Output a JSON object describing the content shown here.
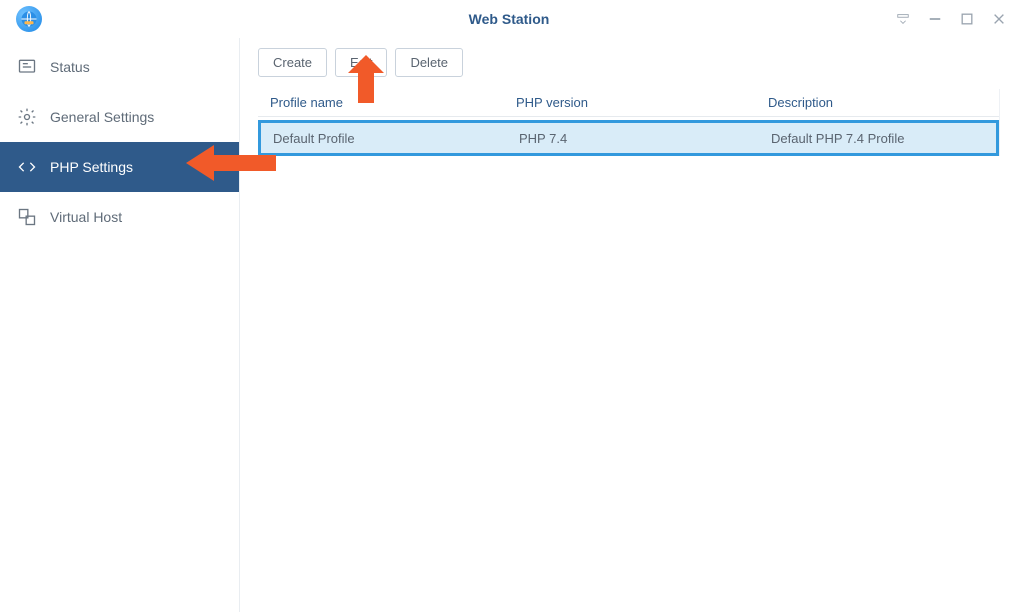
{
  "window": {
    "title": "Web Station"
  },
  "sidebar": {
    "items": [
      {
        "label": "Status"
      },
      {
        "label": "General Settings"
      },
      {
        "label": "PHP Settings"
      },
      {
        "label": "Virtual Host"
      }
    ]
  },
  "toolbar": {
    "create_label": "Create",
    "edit_label": "Edit",
    "delete_label": "Delete"
  },
  "table": {
    "headers": {
      "name": "Profile name",
      "version": "PHP version",
      "description": "Description"
    },
    "rows": [
      {
        "name": "Default Profile",
        "version": "PHP 7.4",
        "description": "Default PHP 7.4 Profile"
      }
    ]
  }
}
